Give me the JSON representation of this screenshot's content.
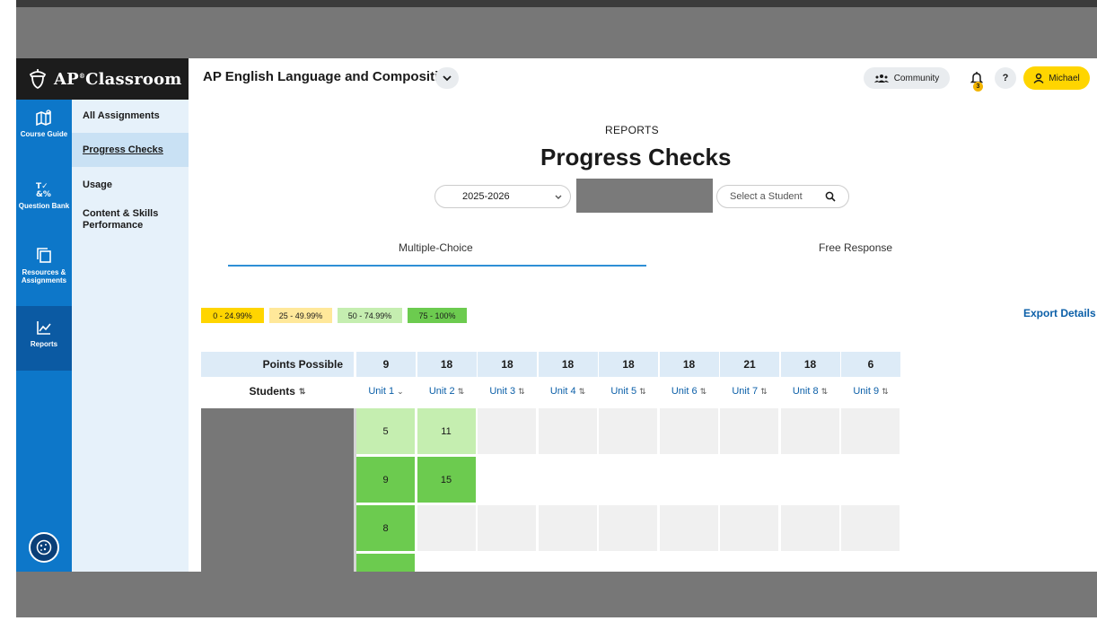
{
  "brand": {
    "name": "AP",
    "reg": "®",
    "name2": "Classroom"
  },
  "rail": {
    "items": [
      {
        "label": "Course Guide"
      },
      {
        "label": "Question Bank"
      },
      {
        "label": "Resources & Assignments"
      },
      {
        "label": "Reports"
      }
    ]
  },
  "subnav": {
    "items": [
      {
        "label": "All Assignments"
      },
      {
        "label": "Progress Checks"
      },
      {
        "label": "Usage"
      },
      {
        "label": "Content & Skills Performance"
      }
    ]
  },
  "header": {
    "course_title": "AP English Language and Composition",
    "community_label": "Community",
    "notifications_count": "3",
    "help_label": "?",
    "user_label": "Michael"
  },
  "main": {
    "kicker": "REPORTS",
    "title": "Progress Checks",
    "year_value": "2025-2026",
    "student_placeholder": "Select a Student",
    "tabs": [
      "Multiple-Choice",
      "Free Response"
    ],
    "legend": [
      {
        "label": "0 - 24.99%",
        "color": "#ffd500"
      },
      {
        "label": "25 - 49.99%",
        "color": "#ffe89a"
      },
      {
        "label": "50 - 74.99%",
        "color": "#c5eeb0"
      },
      {
        "label": "75 - 100%",
        "color": "#6ccb4f"
      }
    ],
    "export_label": "Export Details"
  },
  "table": {
    "points_label": "Points Possible",
    "students_label": "Students",
    "units": [
      {
        "label": "Unit 1",
        "points": "9"
      },
      {
        "label": "Unit 2",
        "points": "18"
      },
      {
        "label": "Unit 3",
        "points": "18"
      },
      {
        "label": "Unit 4",
        "points": "18"
      },
      {
        "label": "Unit 5",
        "points": "18"
      },
      {
        "label": "Unit 6",
        "points": "18"
      },
      {
        "label": "Unit 7",
        "points": "21"
      },
      {
        "label": "Unit 8",
        "points": "18"
      },
      {
        "label": "Unit 9",
        "points": "6"
      }
    ],
    "rows": [
      {
        "cells": [
          "5",
          "11",
          "",
          "",
          "",
          "",
          "",
          "",
          ""
        ]
      },
      {
        "cells": [
          "9",
          "15"
        ]
      },
      {
        "cells": [
          "8",
          "",
          "",
          "",
          "",
          "",
          "",
          "",
          ""
        ]
      },
      {
        "cells": [
          ""
        ]
      }
    ]
  }
}
